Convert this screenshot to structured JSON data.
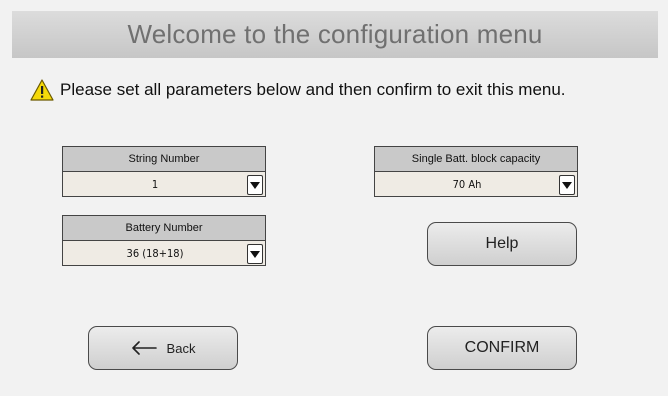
{
  "header": {
    "title": "Welcome to the configuration menu"
  },
  "instruction": {
    "text": "Please set all parameters below and then confirm to exit this menu.",
    "icon": "warning-triangle-icon"
  },
  "fields": {
    "string_number": {
      "label": "String Number",
      "value": "1"
    },
    "battery_number": {
      "label": "Battery Number",
      "value": "36 (18+18)"
    },
    "block_capacity": {
      "label": "Single Batt. block capacity",
      "value": "70 Ah"
    }
  },
  "buttons": {
    "help": "Help",
    "back": "Back",
    "confirm": "CONFIRM"
  },
  "colors": {
    "title_bar": "#cfcfcf",
    "field_label_bg": "#c9c9c9",
    "field_value_bg": "#efebe4",
    "warning": "#f5d90a"
  }
}
